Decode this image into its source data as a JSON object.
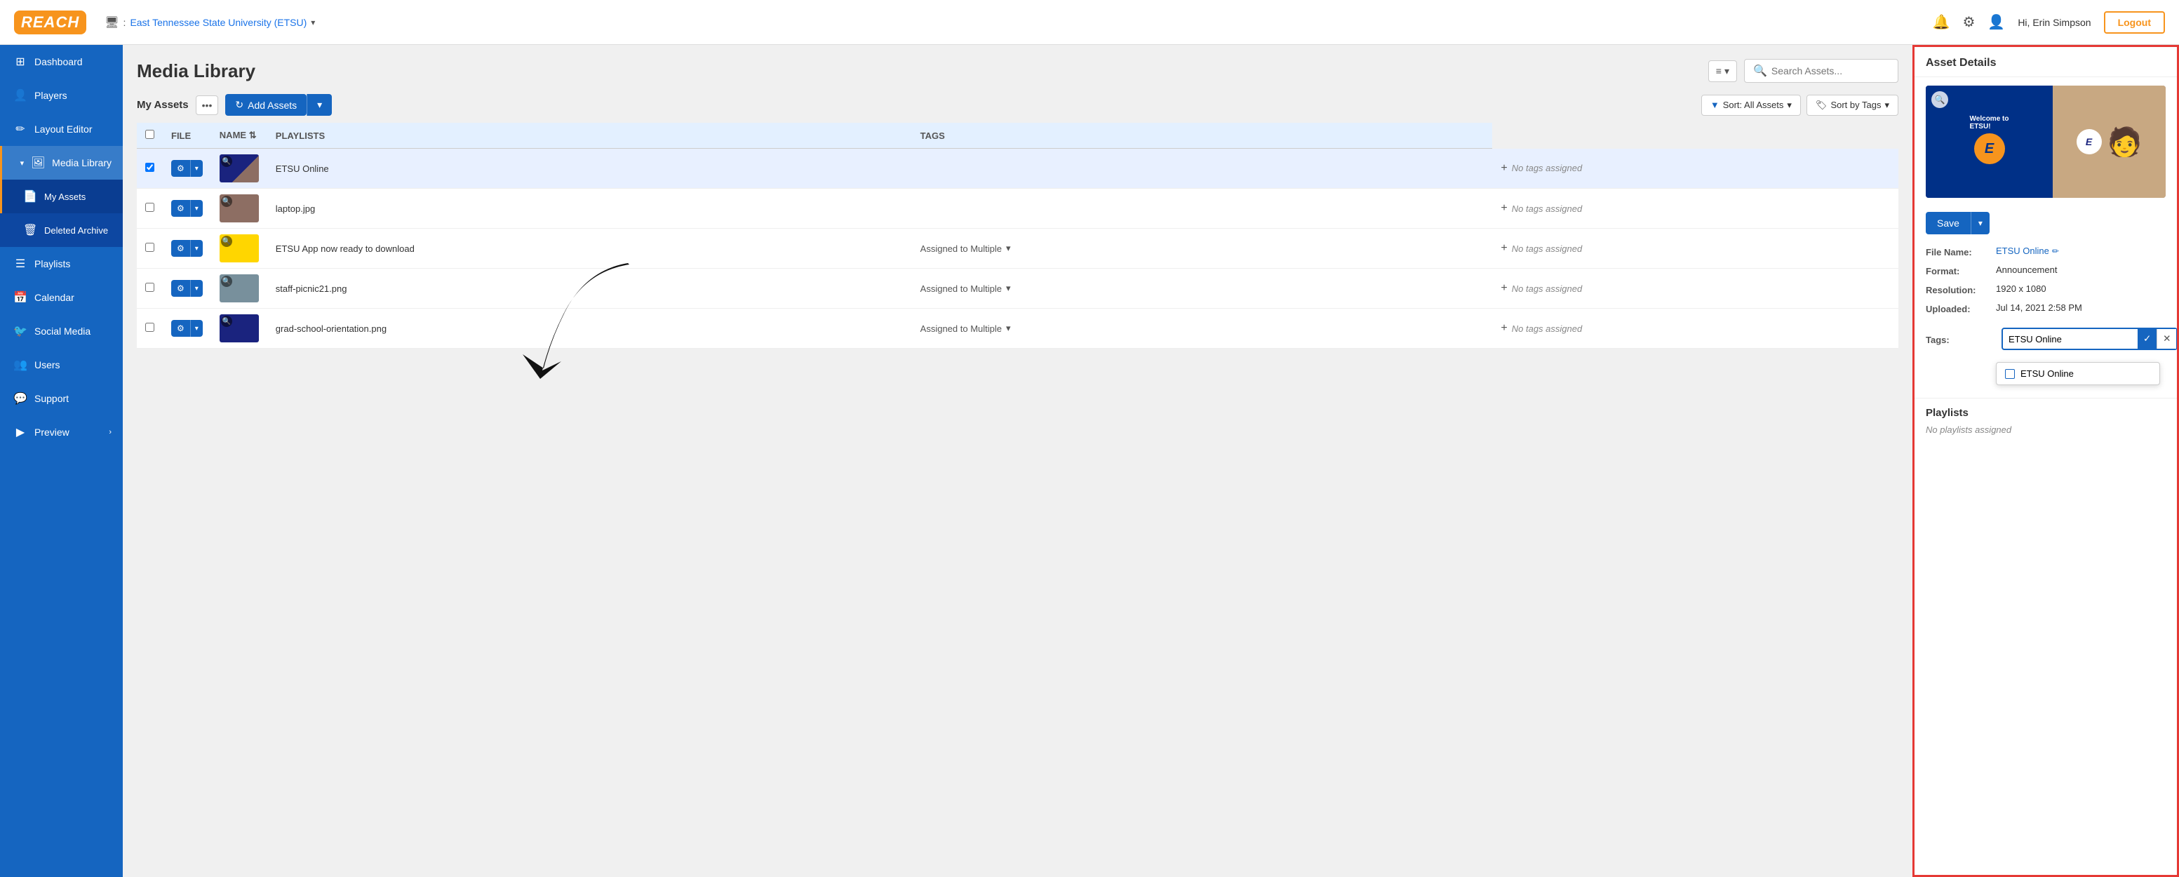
{
  "header": {
    "logo_text": "REACH",
    "org_icon": "🖥",
    "org_name": "East Tennessee State University (ETSU)",
    "user_greeting": "Hi, Erin Simpson",
    "logout_label": "Logout"
  },
  "sidebar": {
    "items": [
      {
        "id": "dashboard",
        "label": "Dashboard",
        "icon": "⊞",
        "active": false
      },
      {
        "id": "players",
        "label": "Players",
        "icon": "👤",
        "active": false
      },
      {
        "id": "layout-editor",
        "label": "Layout Editor",
        "icon": "✏",
        "active": false
      },
      {
        "id": "media-library",
        "label": "Media Library",
        "icon": "🖼",
        "active": true,
        "expanded": true
      },
      {
        "id": "my-assets",
        "label": "My Assets",
        "icon": "📄",
        "active": true,
        "sub": true
      },
      {
        "id": "deleted-archive",
        "label": "Deleted Archive",
        "icon": "🗑",
        "active": false,
        "sub": true
      },
      {
        "id": "playlists",
        "label": "Playlists",
        "icon": "☰",
        "active": false
      },
      {
        "id": "calendar",
        "label": "Calendar",
        "icon": "📅",
        "active": false
      },
      {
        "id": "social-media",
        "label": "Social Media",
        "icon": "🐦",
        "active": false
      },
      {
        "id": "users",
        "label": "Users",
        "icon": "👥",
        "active": false
      },
      {
        "id": "support",
        "label": "Support",
        "icon": "💬",
        "active": false
      },
      {
        "id": "preview",
        "label": "Preview",
        "icon": "▶",
        "active": false,
        "has_arrow": true
      }
    ]
  },
  "media_library": {
    "title": "Media Library",
    "section_label": "My Assets",
    "add_assets_label": "Add Assets",
    "search_placeholder": "Search Assets...",
    "filter_label": "Sort: All Assets",
    "sort_tags_label": "Sort by Tags",
    "columns": {
      "file": "FILE",
      "name": "NAME",
      "playlists": "PLAYLISTS",
      "tags": "TAGS"
    },
    "assets": [
      {
        "id": 1,
        "name": "ETSU Online",
        "playlist": "",
        "tags": "No tags assigned",
        "selected": true,
        "thumb_color": "#1a237e"
      },
      {
        "id": 2,
        "name": "laptop.jpg",
        "playlist": "",
        "tags": "No tags assigned",
        "selected": false,
        "thumb_color": "#8d6e63"
      },
      {
        "id": 3,
        "name": "ETSU App now ready to download",
        "playlist": "Assigned to Multiple",
        "tags": "No tags assigned",
        "selected": false,
        "thumb_color": "#ffd600"
      },
      {
        "id": 4,
        "name": "staff-picnic21.png",
        "playlist": "Assigned to Multiple",
        "tags": "No tags assigned",
        "selected": false,
        "thumb_color": "#78909c"
      },
      {
        "id": 5,
        "name": "grad-school-orientation.png",
        "playlist": "Assigned to Multiple",
        "tags": "No tags assigned",
        "selected": false,
        "thumb_color": "#1a237e"
      }
    ]
  },
  "asset_details": {
    "panel_title": "Asset Details",
    "save_label": "Save",
    "fields": {
      "file_name_label": "File Name:",
      "file_name_value": "ETSU Online",
      "format_label": "Format:",
      "format_value": "Announcement",
      "resolution_label": "Resolution:",
      "resolution_value": "1920 x 1080",
      "uploaded_label": "Uploaded:",
      "uploaded_value": "Jul 14, 2021 2:58 PM",
      "tags_label": "Tags:"
    },
    "tags_input_value": "ETSU Online",
    "tags_dropdown": [
      {
        "label": "ETSU Online",
        "checked": false
      }
    ],
    "playlists_title": "Playlists",
    "no_playlists": "No playlists assigned"
  },
  "colors": {
    "primary": "#1565c0",
    "accent": "#f7941d",
    "danger": "#e53935",
    "sidebar_bg": "#1565c0",
    "table_header_bg": "#e3f0ff"
  }
}
